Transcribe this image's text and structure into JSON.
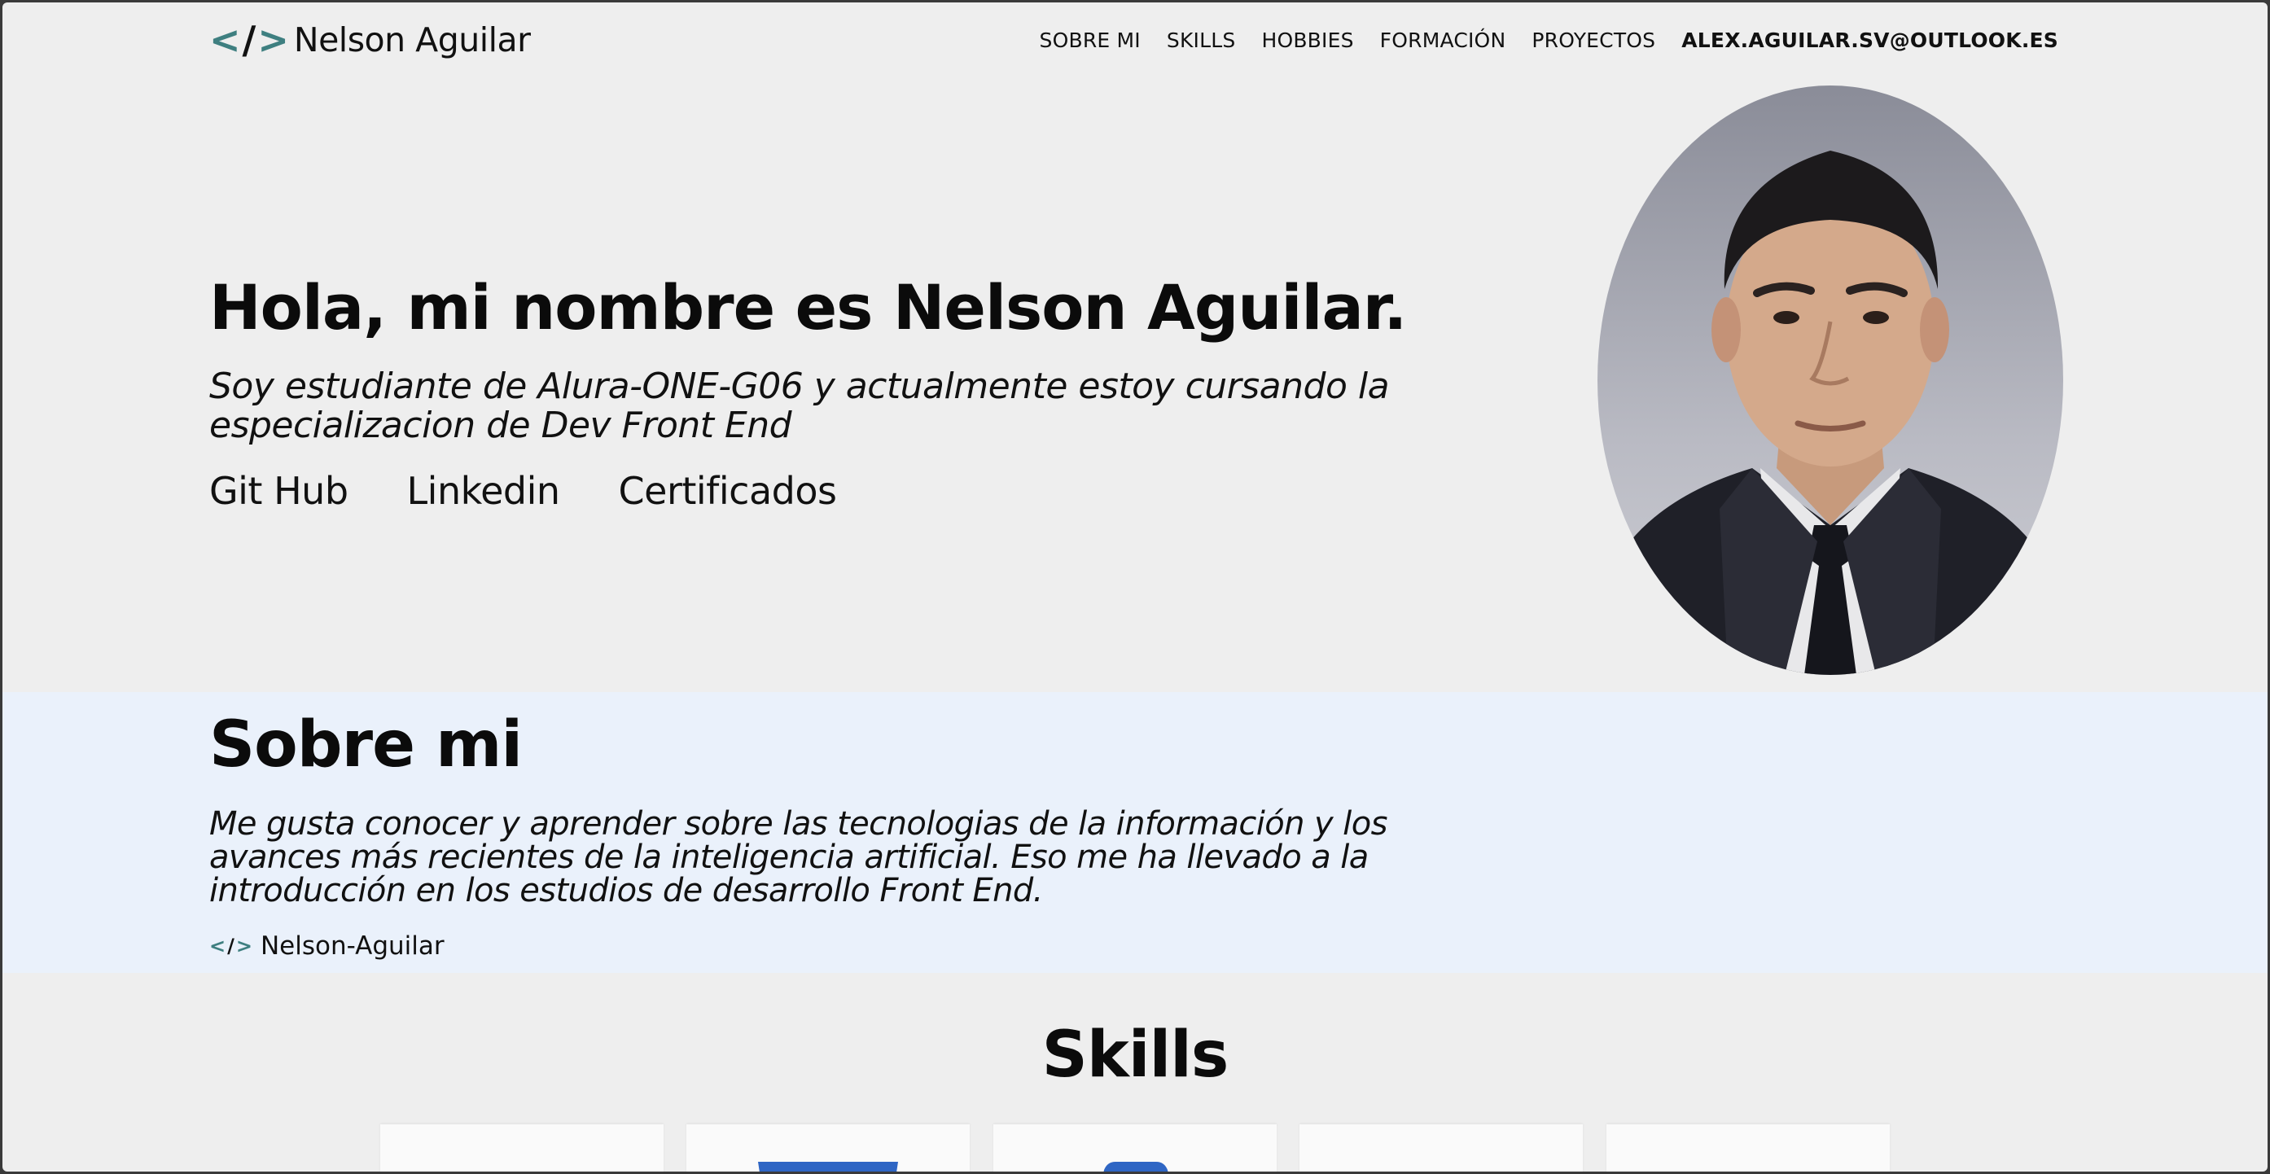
{
  "header": {
    "logo_name": "Nelson Aguilar",
    "logo_icon": "code-brackets-icon",
    "nav": [
      {
        "label": "SOBRE MI"
      },
      {
        "label": "SKILLS"
      },
      {
        "label": "HOBBIES"
      },
      {
        "label": "FORMACIÓN"
      },
      {
        "label": "PROYECTOS"
      },
      {
        "label": "ALEX.AGUILAR.SV@OUTLOOK.ES"
      }
    ]
  },
  "hero": {
    "title": "Hola, mi nombre es Nelson Aguilar.",
    "subtitle": "Soy estudiante de Alura-ONE-G06 y actualmente estoy cursando la especializacion de Dev Front End",
    "links": [
      {
        "label": "Git Hub"
      },
      {
        "label": "Linkedin"
      },
      {
        "label": "Certificados"
      }
    ]
  },
  "about": {
    "title": "Sobre mi",
    "text": "Me gusta conocer y aprender sobre las tecnologias de la información y los avances más recientes de la inteligencia artificial. Eso me ha llevado a la introducción en los estudios de desarrollo Front End.",
    "signature": "Nelson-Aguilar"
  },
  "skills": {
    "title": "Skills",
    "cards": [
      {
        "icon": "blank-skill-icon"
      },
      {
        "icon": "html5-icon"
      },
      {
        "icon": "css3-icon"
      },
      {
        "icon": "blank-skill-icon"
      },
      {
        "icon": "blank-skill-icon"
      }
    ]
  },
  "colors": {
    "accent": "#3e7f80",
    "page_bg": "#eeeeee",
    "about_bg": "#eaf1fb",
    "skill_blue": "#2f66c4"
  }
}
